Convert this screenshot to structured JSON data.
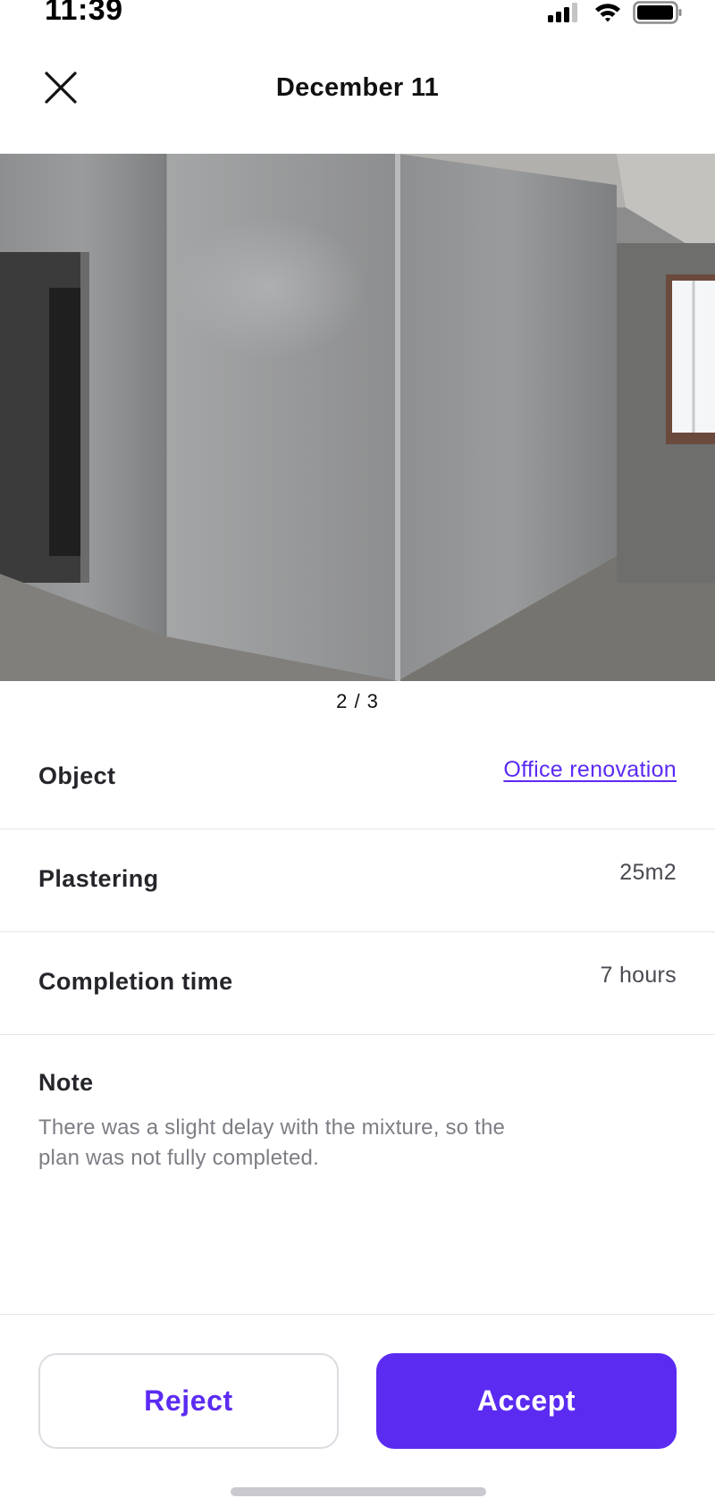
{
  "status_bar": {
    "time": "11:39",
    "icons": [
      "cellular-signal-icon",
      "wifi-icon",
      "battery-icon"
    ]
  },
  "header": {
    "title": "December 11",
    "close_icon": "close-icon"
  },
  "gallery": {
    "photo_subject": "concrete-wall-photo",
    "pager_text": "2 / 3"
  },
  "details": [
    {
      "label": "Object",
      "value": "Office renovation",
      "is_link": true
    },
    {
      "label": "Plastering",
      "value": "25m2",
      "is_link": false
    },
    {
      "label": "Completion time",
      "value": "7 hours",
      "is_link": false
    }
  ],
  "note": {
    "title": "Note",
    "text": "There was a slight delay with the mixture, so the plan was not fully completed."
  },
  "actions": {
    "reject_label": "Reject",
    "accept_label": "Accept"
  },
  "colors": {
    "accent": "#5b2bf2",
    "text_primary": "#25252b",
    "text_secondary": "#7d7d85",
    "divider": "#e6e6ea"
  }
}
